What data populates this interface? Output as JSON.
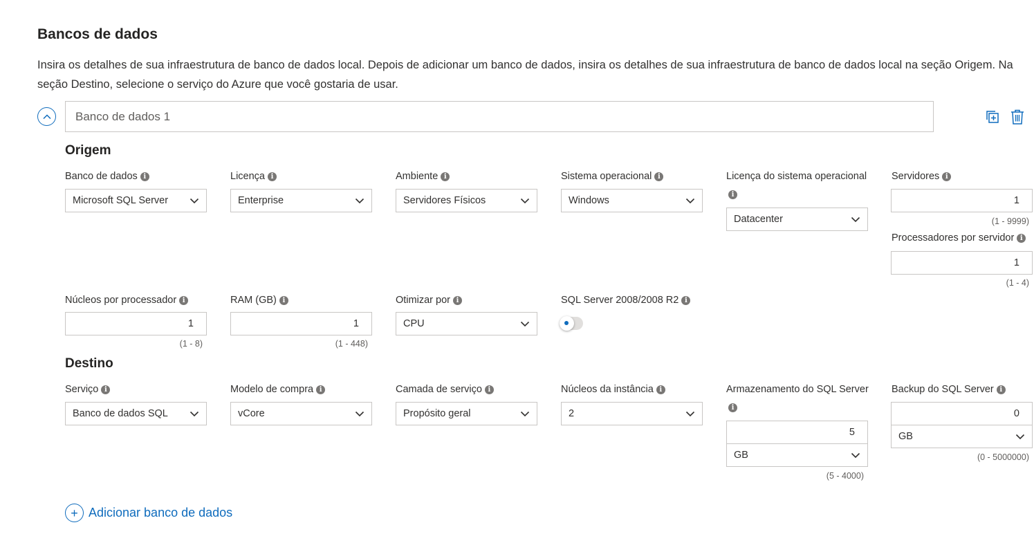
{
  "header": {
    "title": "Bancos de dados",
    "description": "Insira os detalhes de sua infraestrutura de banco de dados local. Depois de adicionar um banco de dados, insira os detalhes de sua infraestrutura de banco de dados local na seção Origem. Na seção Destino, selecione o serviço do Azure que você gostaria de usar."
  },
  "database": {
    "name_placeholder": "Banco de dados 1",
    "icons": {
      "collapse": "chevron-up-icon",
      "duplicate": "duplicate-icon",
      "delete": "trash-icon"
    }
  },
  "origem": {
    "title": "Origem",
    "banco_de_dados": {
      "label": "Banco de dados",
      "value": "Microsoft SQL Server"
    },
    "licenca": {
      "label": "Licença",
      "value": "Enterprise"
    },
    "ambiente": {
      "label": "Ambiente",
      "value": "Servidores Físicos"
    },
    "sistema_operacional": {
      "label": "Sistema operacional",
      "value": "Windows"
    },
    "licenca_so": {
      "label": "Licença do sistema operacional",
      "value": "Datacenter"
    },
    "servidores": {
      "label": "Servidores",
      "value": "1",
      "range": "(1 - 9999)"
    },
    "processadores": {
      "label": "Processadores por servidor",
      "value": "1",
      "range": "(1 - 4)"
    },
    "nucleos": {
      "label": "Núcleos por processador",
      "value": "1",
      "range": "(1 - 8)"
    },
    "ram": {
      "label": "RAM (GB)",
      "value": "1",
      "range": "(1 - 448)"
    },
    "otimizar": {
      "label": "Otimizar por",
      "value": "CPU"
    },
    "sql2008": {
      "label": "SQL Server 2008/2008 R2",
      "on": false
    }
  },
  "destino": {
    "title": "Destino",
    "servico": {
      "label": "Serviço",
      "value": "Banco de dados SQL"
    },
    "modelo": {
      "label": "Modelo de compra",
      "value": "vCore"
    },
    "camada": {
      "label": "Camada de serviço",
      "value": "Propósito geral"
    },
    "nucleos_instancia": {
      "label": "Núcleos da instância",
      "value": "2"
    },
    "armazenamento": {
      "label": "Armazenamento do SQL Server",
      "value": "5",
      "unit": "GB",
      "range": "(5 - 4000)"
    },
    "backup": {
      "label": "Backup do SQL Server",
      "value": "0",
      "unit": "GB",
      "range": "(0 - 5000000)"
    }
  },
  "add_database": {
    "label": "Adicionar banco de dados"
  },
  "colors": {
    "accent": "#0f6cbd",
    "border": "#c8c6c4",
    "text": "#323130"
  }
}
